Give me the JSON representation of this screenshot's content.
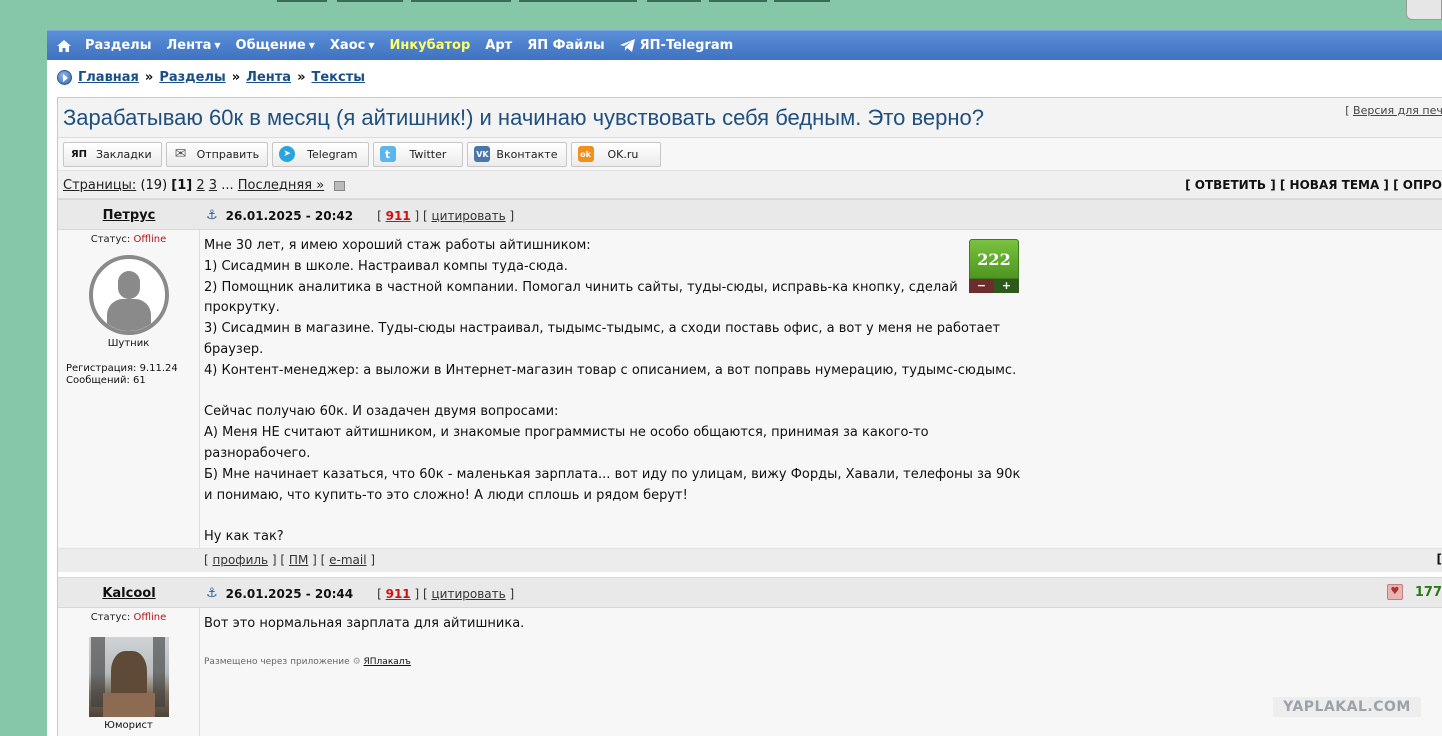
{
  "nav": {
    "items": [
      {
        "label": "Разделы",
        "caret": false
      },
      {
        "label": "Лента",
        "caret": true
      },
      {
        "label": "Общение",
        "caret": true
      },
      {
        "label": "Хаос",
        "caret": true
      },
      {
        "label": "Инкубатор",
        "caret": false
      },
      {
        "label": "Арт",
        "caret": false
      },
      {
        "label": "ЯП Файлы",
        "caret": false
      },
      {
        "label": "ЯП-Telegram",
        "caret": false
      }
    ],
    "caret_glyph": "▼"
  },
  "breadcrumb": [
    "Главная",
    "Разделы",
    "Лента",
    "Тексты"
  ],
  "breadcrumb_sep": "»",
  "topic": {
    "title": "Зарабатываю 60к в месяц (я айтишник!) и начинаю чувствовать себя бедным. Это верно?",
    "print_link": "Версия для печат"
  },
  "share": [
    {
      "label": "Закладки",
      "icon": "yap-icon",
      "color": "#ffffff",
      "glyph": "ЯП"
    },
    {
      "label": "Отправить",
      "icon": "mail-icon",
      "color": "#ffffff",
      "glyph": "✉"
    },
    {
      "label": "Telegram",
      "icon": "telegram-icon",
      "color": "#2aa3de",
      "glyph": "➤"
    },
    {
      "label": "Twitter",
      "icon": "twitter-icon",
      "color": "#5cb6ee",
      "glyph": "t"
    },
    {
      "label": "Вконтакте",
      "icon": "vk-icon",
      "color": "#4a76a8",
      "glyph": "VK"
    },
    {
      "label": "OK.ru",
      "icon": "ok-icon",
      "color": "#f2901d",
      "glyph": "ok"
    }
  ],
  "pagination": {
    "label": "Страницы:",
    "count": "(19)",
    "current": "[1]",
    "pages": [
      "2",
      "3"
    ],
    "ellipsis": "...",
    "last": "Последняя »",
    "actions": "[ ОТВЕТИТЬ ] [ НОВАЯ ТЕМА ] [ ОПРО"
  },
  "posts": [
    {
      "author": "Петрус",
      "date": "26.01.2025 - 20:42",
      "num": "911",
      "quote": "цитировать",
      "status_label": "Статус:",
      "status": "Offline",
      "rank": "Шутник",
      "registration": "Регистрация: 9.11.24",
      "messages": "Сообщений: 61",
      "rating": "222",
      "rating_minus": "−",
      "rating_plus": "+",
      "body": "Мне 30 лет, я имею хороший стаж работы айтишником:\n1) Сисадмин в школе. Настраивал компы туда-сюда.\n2) Помощник аналитика в частной компании. Помогал чинить сайты, туды-сюды, исправь-ка кнопку, сделай прокрутку.\n3) Сисадмин в магазине. Туды-сюды настраивал, тыдымс-тыдымс, а сходи поставь офис, а вот у меня не работает браузер.\n4) Контент-менеджер: а выложи в Интернет-магазин товар с описанием, а вот поправь нумерацию, тудымс-сюдымс.\n\nСейчас получаю 60к. И озадачен двумя вопросами:\nА) Меня НЕ считают айтишником, и знакомые программисты не особо общаются, принимая за какого-то разнорабочего.\nБ) Мне начинает казаться, что 60к - маленькая зарплата... вот иду по улицам, вижу Форды, Хавали, телефоны за 90к и понимаю, что купить-то это сложно! А люди сплошь и рядом берут!\n\nНу как так?",
      "footer": {
        "profile": "профиль",
        "pm": "ПМ",
        "email": "e-mail",
        "right": "["
      }
    },
    {
      "author": "Kalcool",
      "date": "26.01.2025 - 20:44",
      "num": "911",
      "quote": "цитировать",
      "status_label": "Статус:",
      "status": "Offline",
      "rank": "Юморист",
      "body": "Вот это нормальная зарплата для айтишника.",
      "app_note": "Размещено через приложение",
      "app_name": "ЯПлакалъ",
      "votes": "177"
    }
  ],
  "watermark": "YAPLAKAL.COM"
}
